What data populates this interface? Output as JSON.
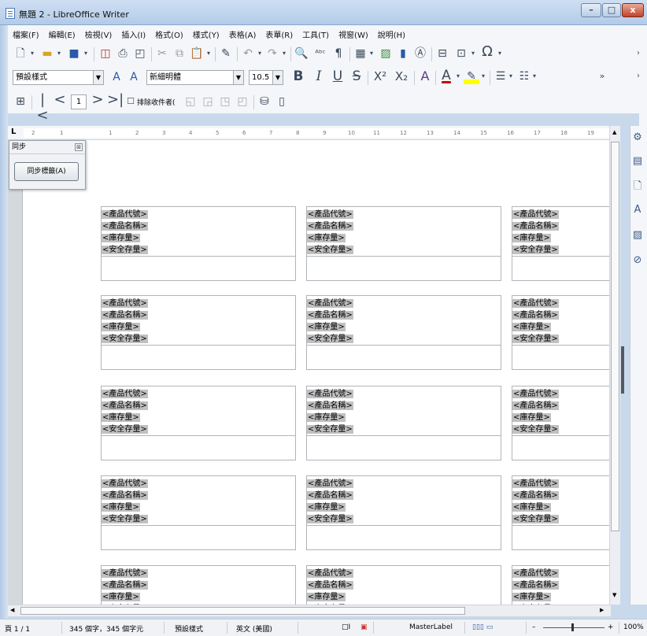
{
  "window": {
    "title": "無題 2 - LibreOffice Writer",
    "minimize": "–",
    "maximize": "□",
    "close": "x"
  },
  "menu": [
    "檔案(F)",
    "編輯(E)",
    "檢視(V)",
    "插入(I)",
    "格式(O)",
    "樣式(Y)",
    "表格(A)",
    "表單(R)",
    "工具(T)",
    "視窗(W)",
    "說明(H)"
  ],
  "formatting": {
    "paragraph_style": "預設樣式",
    "font_name": "新細明體",
    "font_size": "10.5"
  },
  "mailmerge": {
    "record_number": "1",
    "exclude_label": "排除收件者("
  },
  "sync_panel": {
    "title": "同步",
    "button": "同步標籤(A)"
  },
  "labels": [
    {
      "fields": [
        "<產品代號>",
        "<產品名稱>",
        "<庫存量>",
        "<安全存量>"
      ]
    }
  ],
  "label_grid": {
    "rows": 5,
    "columns": 3
  },
  "ruler": {
    "ticks": [
      "2",
      "1",
      "1",
      "2",
      "3",
      "4",
      "5",
      "6",
      "7",
      "8",
      "9",
      "10",
      "11",
      "12",
      "13",
      "14",
      "15",
      "16",
      "17",
      "18",
      "19"
    ]
  },
  "status": {
    "page": "頁 1 / 1",
    "words": "345 個字，345 個字元",
    "page_style": "預設樣式",
    "language": "英文 (美國)",
    "master": "MasterLabel",
    "zoom": "100%"
  },
  "icons": {
    "new": "new-document-icon",
    "open": "open-folder-icon",
    "save": "save-icon",
    "export_pdf": "export-pdf-icon",
    "print": "print-icon",
    "preview": "print-preview-icon",
    "cut": "cut-icon",
    "copy": "copy-icon",
    "paste": "paste-icon",
    "clone": "clone-format-icon",
    "undo": "undo-icon",
    "redo": "redo-icon",
    "find": "find-replace-icon",
    "spell": "spellcheck-icon",
    "formatting_marks": "pilcrow-icon",
    "table": "table-icon",
    "image": "image-icon",
    "chart": "chart-icon",
    "textbox": "textbox-icon",
    "page_break": "page-break-icon",
    "field": "field-icon",
    "special_char": "omega-icon"
  },
  "colors": {
    "font_color": "#cc0000",
    "highlight": "#ffff00",
    "field_shade": "#c0c0c0"
  }
}
